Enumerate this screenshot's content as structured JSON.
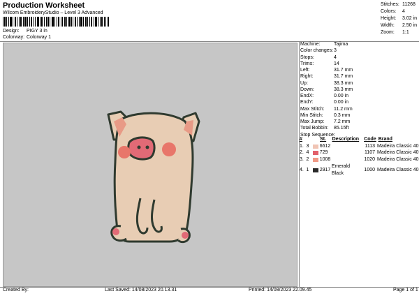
{
  "header": {
    "title": "Production Worksheet",
    "subtitle": "Wilcom EmbroideryStudio – Level 3 Advanced",
    "design_label": "Design:",
    "design_value": "PIGY 3 in",
    "colorway_label": "Colorway:",
    "colorway_value": "Colorway 1"
  },
  "stats": [
    {
      "label": "Stitches:",
      "value": "11268"
    },
    {
      "label": "Colors:",
      "value": "4"
    },
    {
      "label": "Height:",
      "value": "3.02 in"
    },
    {
      "label": "Width:",
      "value": "2.50 in"
    },
    {
      "label": "Zoom:",
      "value": "1:1"
    }
  ],
  "info": [
    {
      "label": "Machine:",
      "value": "Tajima"
    },
    {
      "label": "Color changes:",
      "value": "3"
    },
    {
      "label": "Stops:",
      "value": "4"
    },
    {
      "label": "Trims:",
      "value": "14"
    },
    {
      "label": "Left:",
      "value": "31.7 mm"
    },
    {
      "label": "Right:",
      "value": "31.7 mm"
    },
    {
      "label": "Up:",
      "value": "38.3 mm"
    },
    {
      "label": "Down:",
      "value": "38.3 mm"
    },
    {
      "label": "EndX:",
      "value": "0.00 in"
    },
    {
      "label": "EndY:",
      "value": "0.00 in"
    },
    {
      "label": "Max Stitch:",
      "value": "11.2 mm"
    },
    {
      "label": "Min Stitch:",
      "value": "0.3 mm"
    },
    {
      "label": "Max Jump:",
      "value": "7.2 mm"
    },
    {
      "label": "Total Bobbin:",
      "value": "85.15ft"
    }
  ],
  "stop_sequence": {
    "title": "Stop Sequence:",
    "headers": {
      "num": "#",
      "st": "St.",
      "desc": "Description",
      "code": "Code",
      "brand": "Brand"
    },
    "rows": [
      {
        "idx": "1.",
        "stop": "3",
        "color": "#f0c4b4",
        "num": "6612",
        "desc": "",
        "code": "1113",
        "brand": "Madeira Classic 40"
      },
      {
        "idx": "2.",
        "stop": "4",
        "color": "#e2606a",
        "num": "729",
        "desc": "",
        "code": "1107",
        "brand": "Madeira Classic 40"
      },
      {
        "idx": "3.",
        "stop": "2",
        "color": "#f09a86",
        "num": "1008",
        "desc": "",
        "code": "1020",
        "brand": "Madeira Classic 40"
      },
      {
        "idx": "4.",
        "stop": "1",
        "color": "#2a2a2a",
        "num": "2917",
        "desc": "Emerald Black",
        "code": "1000",
        "brand": "Madeira Classic 40"
      }
    ]
  },
  "footer": {
    "created_by": "Created By:",
    "last_saved": "Last Saved: 14/08/2023 20.13.31",
    "printed": "Printed: 14/08/2023 22.09.45",
    "page": "Page 1 of 1"
  },
  "colors": {
    "canvas_bg": "#c6c6c6",
    "pig_body": "#e8cdb4",
    "pig_outline": "#2f3a2f",
    "cheeks": "#e8766a",
    "snout": "#e26a76"
  }
}
